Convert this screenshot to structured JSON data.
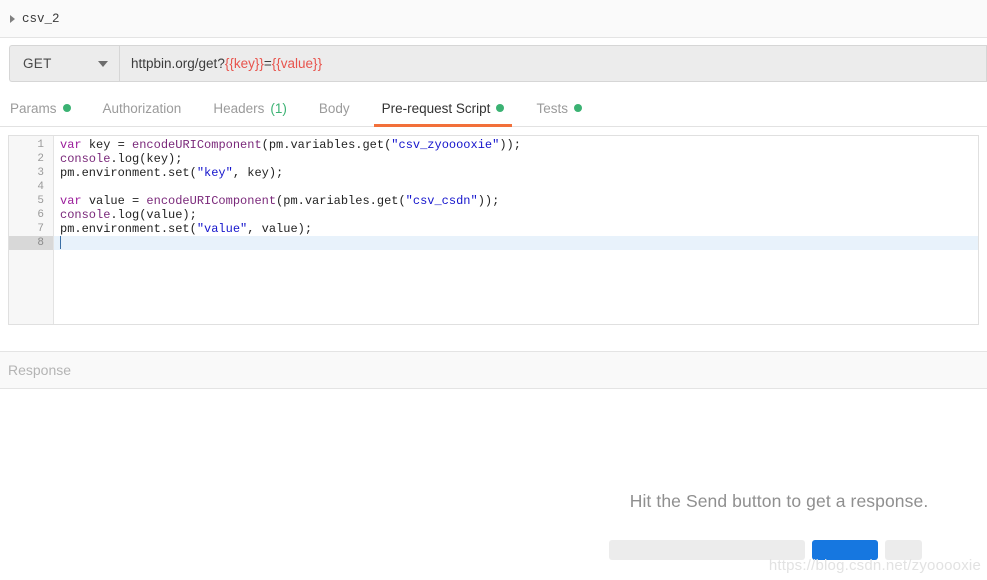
{
  "request_tab": {
    "name": "csv_2",
    "expand_icon": "triangle-right-icon"
  },
  "urlbar": {
    "method": "GET",
    "method_caret_icon": "caret-down-icon",
    "url_static": "httpbin.org/get?",
    "url_var_key": "{{key}}",
    "url_eq": "=",
    "url_var_value": "{{value}}"
  },
  "section_tabs": [
    {
      "label": "Params",
      "dot": true,
      "count": "",
      "active": false
    },
    {
      "label": "Authorization",
      "dot": false,
      "count": "",
      "active": false
    },
    {
      "label": "Headers",
      "dot": false,
      "count": "(1)",
      "active": false
    },
    {
      "label": "Body",
      "dot": false,
      "count": "",
      "active": false
    },
    {
      "label": "Pre-request Script",
      "dot": true,
      "count": "",
      "active": true
    },
    {
      "label": "Tests",
      "dot": true,
      "count": "",
      "active": false
    }
  ],
  "editor": {
    "line_numbers": [
      "1",
      "2",
      "3",
      "4",
      "5",
      "6",
      "7",
      "8"
    ],
    "cursor_line": 8,
    "lines": [
      "var key = encodeURIComponent(pm.variables.get(\"csv_zyooooxie\"));",
      "console.log(key);",
      "pm.environment.set(\"key\", key);",
      "",
      "var value = encodeURIComponent(pm.variables.get(\"csv_csdn\"));",
      "console.log(value);",
      "pm.environment.set(\"value\", value);",
      ""
    ],
    "tokens": [
      [
        {
          "t": "var ",
          "c": "k"
        },
        {
          "t": "key = ",
          "c": "p"
        },
        {
          "t": "encodeURIComponent",
          "c": "fn"
        },
        {
          "t": "(",
          "c": "p"
        },
        {
          "t": "pm",
          "c": "p"
        },
        {
          "t": ".variables.get(",
          "c": "p"
        },
        {
          "t": "\"csv_zyooooxie\"",
          "c": "s"
        },
        {
          "t": "));",
          "c": "p"
        }
      ],
      [
        {
          "t": "console",
          "c": "ob"
        },
        {
          "t": ".log(key);",
          "c": "p"
        }
      ],
      [
        {
          "t": "pm.environment.set(",
          "c": "p"
        },
        {
          "t": "\"key\"",
          "c": "s"
        },
        {
          "t": ", key);",
          "c": "p"
        }
      ],
      [
        {
          "t": "",
          "c": "p"
        }
      ],
      [
        {
          "t": "var ",
          "c": "k"
        },
        {
          "t": "value = ",
          "c": "p"
        },
        {
          "t": "encodeURIComponent",
          "c": "fn"
        },
        {
          "t": "(pm.variables.get(",
          "c": "p"
        },
        {
          "t": "\"csv_csdn\"",
          "c": "s"
        },
        {
          "t": "));",
          "c": "p"
        }
      ],
      [
        {
          "t": "console",
          "c": "ob"
        },
        {
          "t": ".log(value);",
          "c": "p"
        }
      ],
      [
        {
          "t": "pm.environment.set(",
          "c": "p"
        },
        {
          "t": "\"value\"",
          "c": "s"
        },
        {
          "t": ", value);",
          "c": "p"
        }
      ],
      [
        {
          "t": "",
          "c": "p"
        }
      ]
    ]
  },
  "response": {
    "label": "Response",
    "empty_message": "Hit the Send button to get a response.",
    "placeholders": [
      "long",
      "send",
      "short"
    ]
  },
  "watermark": "https://blog.csdn.net/zyooooxie",
  "colors": {
    "accent_orange": "#f2703a",
    "dot_green": "#3bb273",
    "url_variable_red": "#e8544d",
    "send_blue": "#1677e0"
  }
}
